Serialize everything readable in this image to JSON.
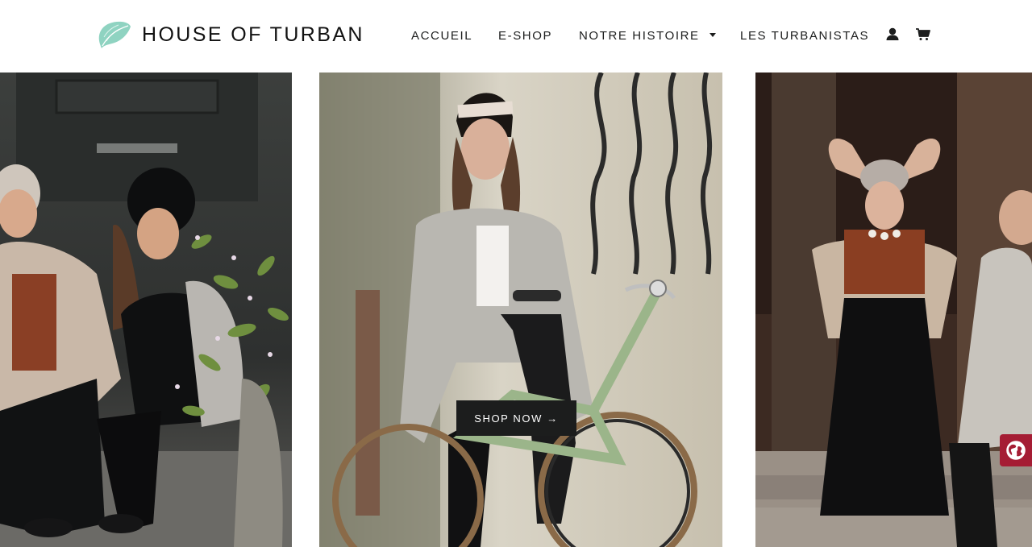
{
  "brand": {
    "name": "HOUSE OF TURBAN",
    "logo_icon": "turban-leaf-icon",
    "logo_color": "#8fd3c1"
  },
  "nav": {
    "items": [
      {
        "label": "ACCUEIL"
      },
      {
        "label": "E-SHOP"
      },
      {
        "label": "NOTRE HISTOIRE",
        "has_dropdown": true,
        "dropdown_icon": "caret-down-icon"
      },
      {
        "label": "LES TURBANISTAS"
      }
    ],
    "account_icon": "user-icon",
    "cart_icon": "cart-icon"
  },
  "hero": {
    "cta_label": "SHOP NOW →",
    "panels": [
      {
        "icon": "photo-two-women-sitting"
      },
      {
        "icon": "photo-woman-on-bicycle"
      },
      {
        "icon": "photo-woman-on-steps"
      }
    ]
  },
  "language_widget": {
    "icon": "globe-icon",
    "color": "#a51d34"
  },
  "colors": {
    "text": "#1c1d1d",
    "background": "#ffffff",
    "button": "#1c1d1d"
  }
}
